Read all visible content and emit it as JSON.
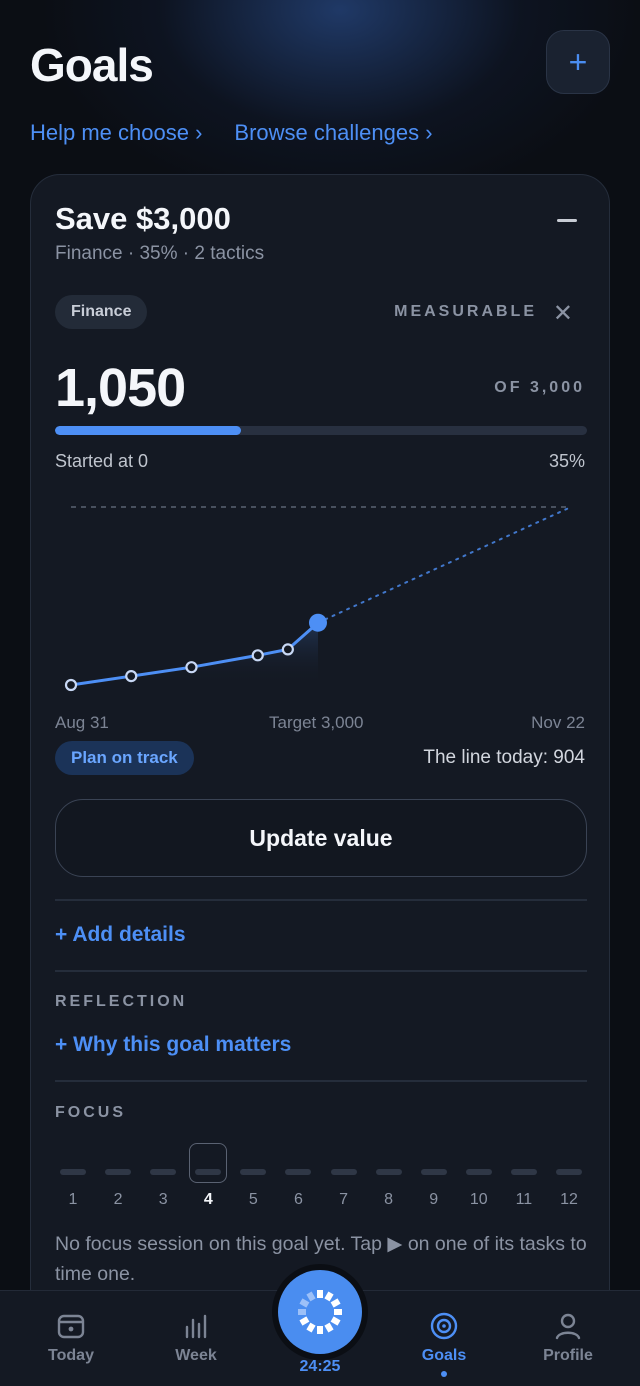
{
  "page": {
    "title": "Goals",
    "add_label": "+"
  },
  "links": {
    "help": "Help me choose ›",
    "browse": "Browse challenges ›"
  },
  "goal": {
    "title": "Save $3,000",
    "meta": "Finance · 35% · 2 tactics",
    "category": "Finance",
    "type_label": "MEASURABLE",
    "current_value": "1,050",
    "target_label": "OF 3,000",
    "progress_fraction": 0.35,
    "started_label": "Started at 0",
    "percent_label": "35%",
    "status_label": "Plan on track",
    "line_today": "The line today: 904",
    "update_button": "Update value",
    "add_details": "+ Add details",
    "reflection_heading": "REFLECTION",
    "reflection_link": "+ Why this goal matters",
    "focus_heading": "FOCUS",
    "focus_weeks": [
      "1",
      "2",
      "3",
      "4",
      "5",
      "6",
      "7",
      "8",
      "9",
      "10",
      "11",
      "12"
    ],
    "focus_selected_index": 3,
    "focus_note": "No focus session on this goal yet. Tap ▶ on one of its tasks to time one."
  },
  "chart_data": {
    "type": "line",
    "x_start_label": "Aug 31",
    "x_end_label": "Nov 22",
    "target_label": "Target 3,000",
    "target": 3000,
    "ylim": [
      0,
      3000
    ],
    "x_range_days": 83,
    "series": [
      {
        "values_x": [
          0,
          10,
          20,
          31,
          36,
          41
        ],
        "values_y": [
          0,
          150,
          300,
          500,
          600,
          1050
        ]
      }
    ],
    "plan_line_end": {
      "x": 83,
      "y": 3000
    },
    "accent": "#4d8ff5"
  },
  "tabs": [
    {
      "label": "Today",
      "icon": "calendar-icon"
    },
    {
      "label": "Week",
      "icon": "bar-chart-icon"
    },
    {
      "label": "Goals",
      "icon": "target-icon",
      "active": true
    },
    {
      "label": "Profile",
      "icon": "person-icon"
    }
  ],
  "timer": {
    "label": "24:25"
  }
}
